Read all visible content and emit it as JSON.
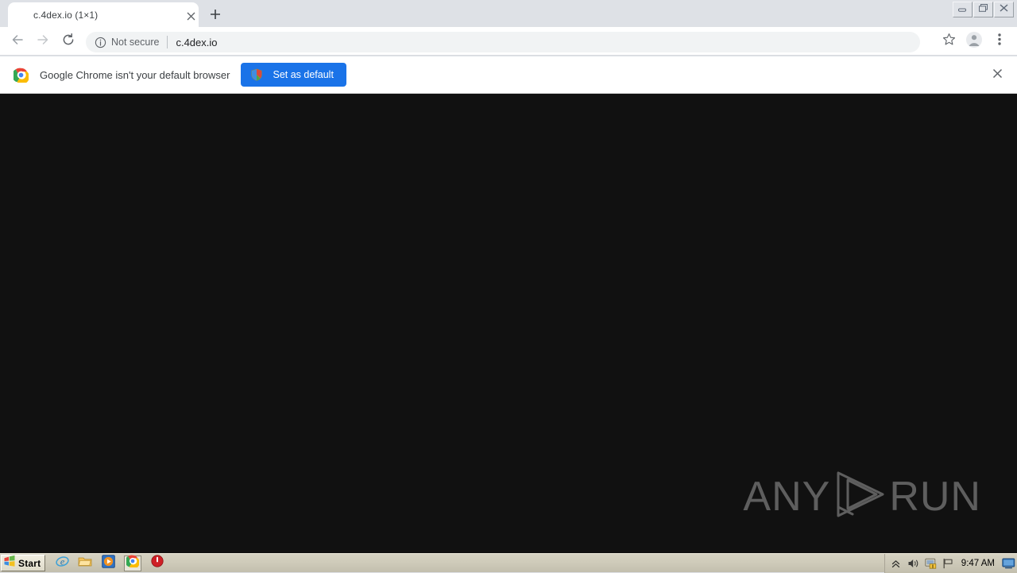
{
  "browser": {
    "tab": {
      "title": "c.4dex.io (1×1)",
      "close_icon": "close-icon"
    },
    "new_tab_icon": "plus-icon",
    "window_controls": [
      {
        "name": "minimize-button",
        "icon": "minimize-icon"
      },
      {
        "name": "restore-button",
        "icon": "restore-icon"
      },
      {
        "name": "close-button",
        "icon": "close-icon"
      }
    ],
    "toolbar": {
      "back_icon": "arrow-left-icon",
      "forward_icon": "arrow-right-icon",
      "reload_icon": "reload-icon",
      "bookmark_icon": "star-icon",
      "profile_icon": "avatar-icon",
      "menu_icon": "three-dots-icon"
    },
    "omnibox": {
      "info_icon": "info-circle-icon",
      "security_label": "Not secure",
      "url": "c.4dex.io"
    },
    "infobar": {
      "chrome_logo_icon": "chrome-logo-icon",
      "message": "Google Chrome isn't your default browser",
      "button_label": "Set as default",
      "button_icon": "windows-shield-icon",
      "button_color": "#1a73e8",
      "close_icon": "close-icon"
    }
  },
  "page": {
    "background_color": "#111111",
    "watermark": {
      "left_text": "ANY",
      "right_text": "RUN",
      "logo_icon": "anyrun-play-logo-icon",
      "color": "#c9c9c9"
    }
  },
  "taskbar": {
    "start_label": "Start",
    "start_icon": "windows-flag-icon",
    "quick_launch": [
      {
        "name": "taskbar-item-internet-explorer",
        "icon": "internet-explorer-icon",
        "active": false
      },
      {
        "name": "taskbar-item-file-explorer",
        "icon": "folder-icon",
        "active": false
      },
      {
        "name": "taskbar-item-media-player",
        "icon": "media-player-icon",
        "active": false
      },
      {
        "name": "taskbar-item-chrome",
        "icon": "chrome-logo-icon",
        "active": true
      },
      {
        "name": "taskbar-item-shutdown",
        "icon": "red-power-icon",
        "active": false
      }
    ],
    "tray": {
      "icons": [
        {
          "name": "tray-show-hidden-icon",
          "icon": "chevron-up-icon"
        },
        {
          "name": "tray-volume-icon",
          "icon": "speaker-icon"
        },
        {
          "name": "tray-security-icon",
          "icon": "security-alert-icon"
        },
        {
          "name": "tray-network-icon",
          "icon": "flag-icon"
        }
      ],
      "clock": "9:47 AM",
      "show_desktop_icon": "show-desktop-icon"
    }
  }
}
